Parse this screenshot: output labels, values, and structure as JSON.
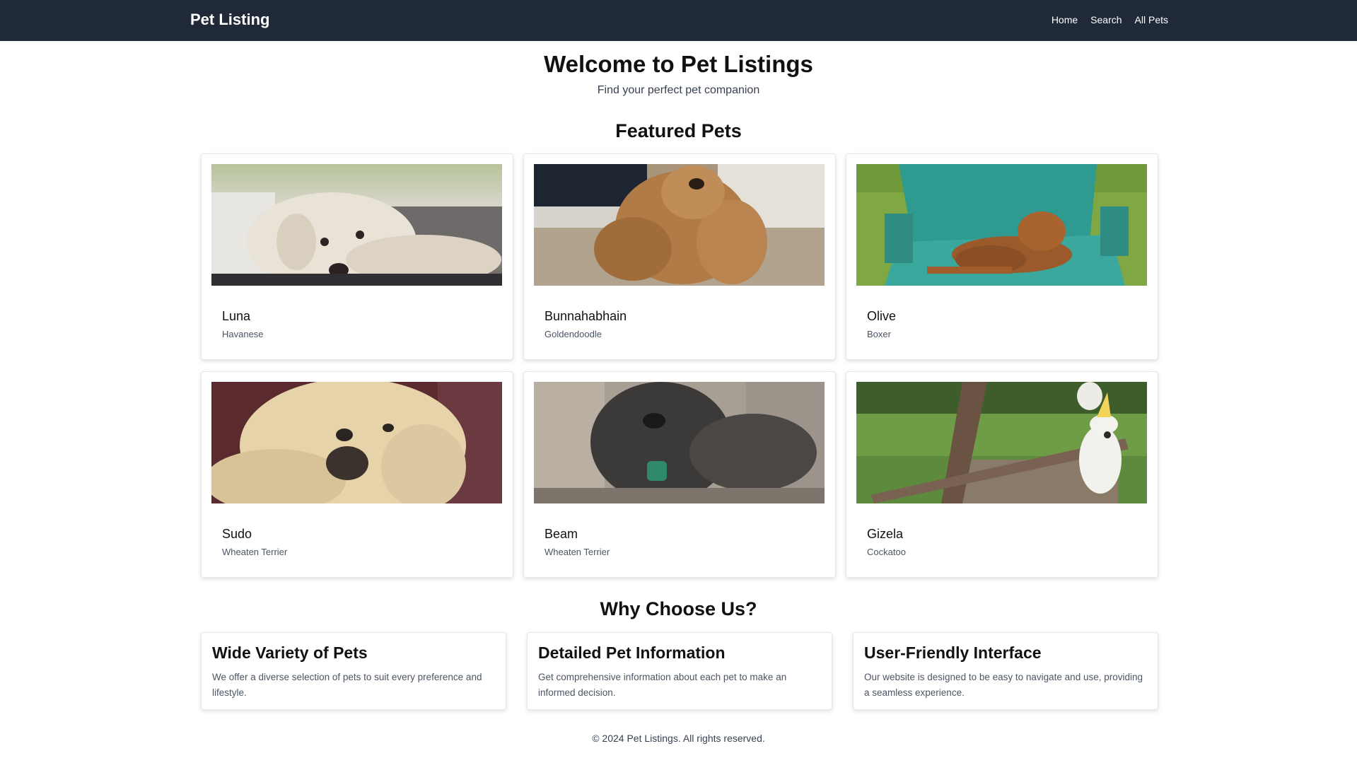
{
  "nav": {
    "brand": "Pet Listing",
    "links": [
      "Home",
      "Search",
      "All Pets"
    ]
  },
  "hero": {
    "title": "Welcome to Pet Listings",
    "subtitle": "Find your perfect pet companion"
  },
  "featured": {
    "title": "Featured Pets",
    "pets": [
      {
        "name": "Luna",
        "breed": "Havanese",
        "photo": "white-dog-photo"
      },
      {
        "name": "Bunnahabhain",
        "breed": "Goldendoodle",
        "photo": "curly-tan-dog-photo"
      },
      {
        "name": "Olive",
        "breed": "Boxer",
        "photo": "brown-dog-on-chair-photo"
      },
      {
        "name": "Sudo",
        "breed": "Wheaten Terrier",
        "photo": "wheaten-dog-closeup-photo"
      },
      {
        "name": "Beam",
        "breed": "Wheaten Terrier",
        "photo": "gray-dog-photo"
      },
      {
        "name": "Gizela",
        "breed": "Cockatoo",
        "photo": "cockatoo-on-branch-photo"
      }
    ]
  },
  "why": {
    "title": "Why Choose Us?",
    "features": [
      {
        "title": "Wide Variety of Pets",
        "text": "We offer a diverse selection of pets to suit every preference and lifestyle."
      },
      {
        "title": "Detailed Pet Information",
        "text": "Get comprehensive information about each pet to make an informed decision."
      },
      {
        "title": "User-Friendly Interface",
        "text": "Our website is designed to be easy to navigate and use, providing a seamless experience."
      }
    ]
  },
  "footer": {
    "text": "© 2024 Pet Listings. All rights reserved."
  },
  "colors": {
    "navbar": "#1f2937",
    "text": "#111111",
    "muted": "#4b5563"
  }
}
